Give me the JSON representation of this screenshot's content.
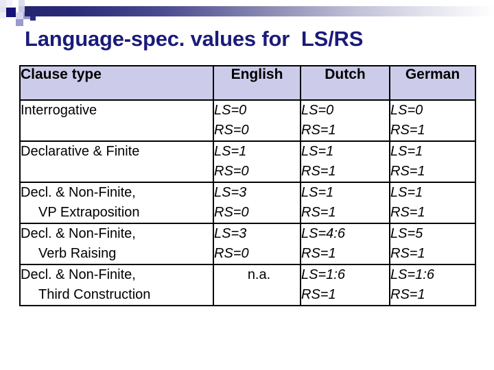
{
  "slide": {
    "title": "Language-spec. values for  LS/RS",
    "title_color": "#1b1b7a",
    "banner_start_color": "#25256f",
    "banner_end_color": "#ffffff",
    "header_fill": "#ccccea"
  },
  "table": {
    "headers": {
      "clause": "Clause type",
      "english": "English",
      "dutch": "Dutch",
      "german": "German"
    },
    "rows": [
      {
        "clause_line1": "Interrogative",
        "clause_line2": "",
        "english": {
          "ls": "LS=0",
          "rs": "RS=0",
          "plain": ""
        },
        "dutch": {
          "ls": "LS=0",
          "rs": "RS=1",
          "plain": ""
        },
        "german": {
          "ls": "LS=0",
          "rs": "RS=1",
          "plain": ""
        }
      },
      {
        "clause_line1": "Declarative & Finite",
        "clause_line2": "",
        "english": {
          "ls": "LS=1",
          "rs": "RS=0",
          "plain": ""
        },
        "dutch": {
          "ls": "LS=1",
          "rs": "RS=1",
          "plain": ""
        },
        "german": {
          "ls": "LS=1",
          "rs": "RS=1",
          "plain": ""
        }
      },
      {
        "clause_line1": "Decl. & Non-Finite,",
        "clause_line2": "VP Extraposition",
        "english": {
          "ls": "LS=3",
          "rs": "RS=0",
          "plain": ""
        },
        "dutch": {
          "ls": "LS=1",
          "rs": "RS=1",
          "plain": ""
        },
        "german": {
          "ls": "LS=1",
          "rs": "RS=1",
          "plain": ""
        }
      },
      {
        "clause_line1": "Decl. & Non-Finite,",
        "clause_line2": "Verb Raising",
        "english": {
          "ls": "LS=3",
          "rs": "RS=0",
          "plain": ""
        },
        "dutch": {
          "ls": "LS=4:6",
          "rs": "RS=1",
          "plain": ""
        },
        "german": {
          "ls": "LS=5",
          "rs": "RS=1",
          "plain": ""
        }
      },
      {
        "clause_line1": "Decl. & Non-Finite,",
        "clause_line2": "Third Construction",
        "english": {
          "ls": "",
          "rs": "",
          "plain": "n.a."
        },
        "dutch": {
          "ls": "LS=1:6",
          "rs": "RS=1",
          "plain": ""
        },
        "german": {
          "ls": "LS=1:6",
          "rs": "RS=1",
          "plain": ""
        }
      }
    ]
  }
}
